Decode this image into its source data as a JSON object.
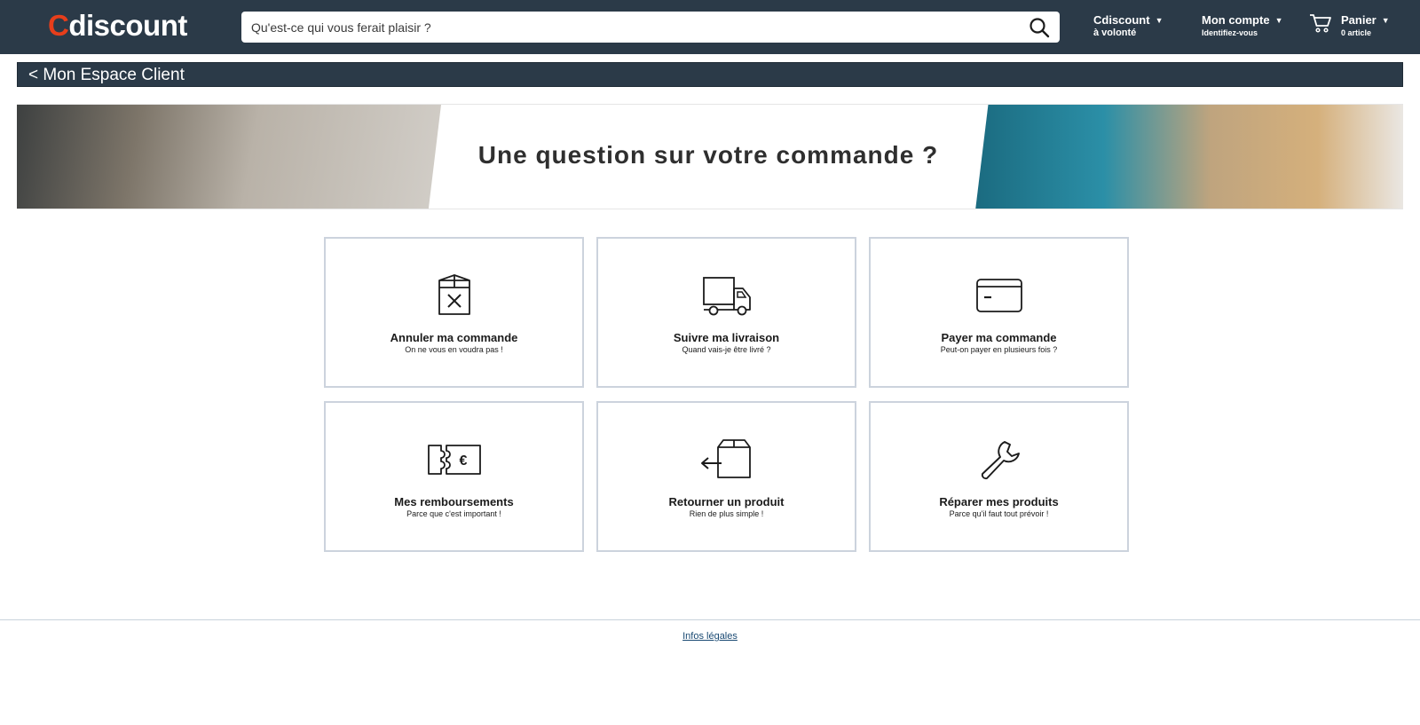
{
  "header": {
    "logo_c": "C",
    "logo_rest": "discount",
    "search_placeholder": "Qu'est-ce qui vous ferait plaisir ?",
    "menu1_main": "Cdiscount",
    "menu1_sub": "à volonté",
    "menu2_main": "Mon compte",
    "menu2_sub": "Identifiez-vous",
    "cart_main": "Panier",
    "cart_sub": "0 article",
    "caret": "▼"
  },
  "breadcrumb": {
    "label": "< Mon Espace Client"
  },
  "banner": {
    "title": "Une question sur votre commande ?"
  },
  "cards": [
    {
      "title": "Annuler ma commande",
      "subtitle": "On ne vous en voudra pas !",
      "icon": "cancel-box-icon"
    },
    {
      "title": "Suivre ma livraison",
      "subtitle": "Quand vais-je être livré ?",
      "icon": "truck-icon"
    },
    {
      "title": "Payer ma commande",
      "subtitle": "Peut-on payer en plusieurs fois ?",
      "icon": "credit-card-icon"
    },
    {
      "title": "Mes remboursements",
      "subtitle": "Parce que c'est important !",
      "icon": "euro-ticket-icon"
    },
    {
      "title": "Retourner un produit",
      "subtitle": "Rien de plus simple !",
      "icon": "return-box-icon"
    },
    {
      "title": "Réparer mes produits",
      "subtitle": "Parce qu'il faut tout prévoir !",
      "icon": "wrench-icon"
    }
  ],
  "colors": {
    "header_bg": "#2b3a48",
    "logo_accent": "#e73e1b",
    "card_border": "#ccd3dd"
  },
  "footer": {
    "legal_link": "Infos légales"
  }
}
